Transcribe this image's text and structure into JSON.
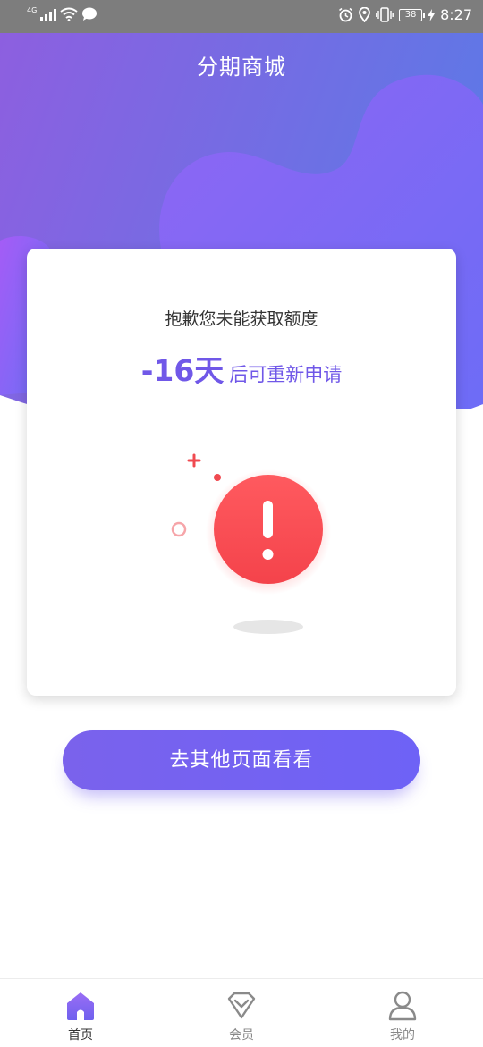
{
  "status_bar": {
    "network": "4G",
    "battery": "38",
    "time": "8:27",
    "icons": [
      "signal-icon",
      "wifi-icon",
      "message-icon",
      "alarm-icon",
      "location-icon",
      "vibrate-icon",
      "battery-icon",
      "charging-icon"
    ]
  },
  "header": {
    "title": "分期商城",
    "gradient_colors": [
      "#8d5fe0",
      "#5f76e5"
    ]
  },
  "card": {
    "message": "抱歉您未能获取额度",
    "countdown_value": "-16天",
    "countdown_suffix": "后可重新申请",
    "accent_color": "#7058e8",
    "illustration": "alert-exclamation-icon",
    "alert_color": "#ff4e55"
  },
  "action_button": {
    "label": "去其他页面看看"
  },
  "bottom_nav": {
    "items": [
      {
        "label": "首页",
        "icon": "home-icon",
        "active": true
      },
      {
        "label": "会员",
        "icon": "diamond-icon",
        "active": false
      },
      {
        "label": "我的",
        "icon": "user-icon",
        "active": false
      }
    ]
  }
}
